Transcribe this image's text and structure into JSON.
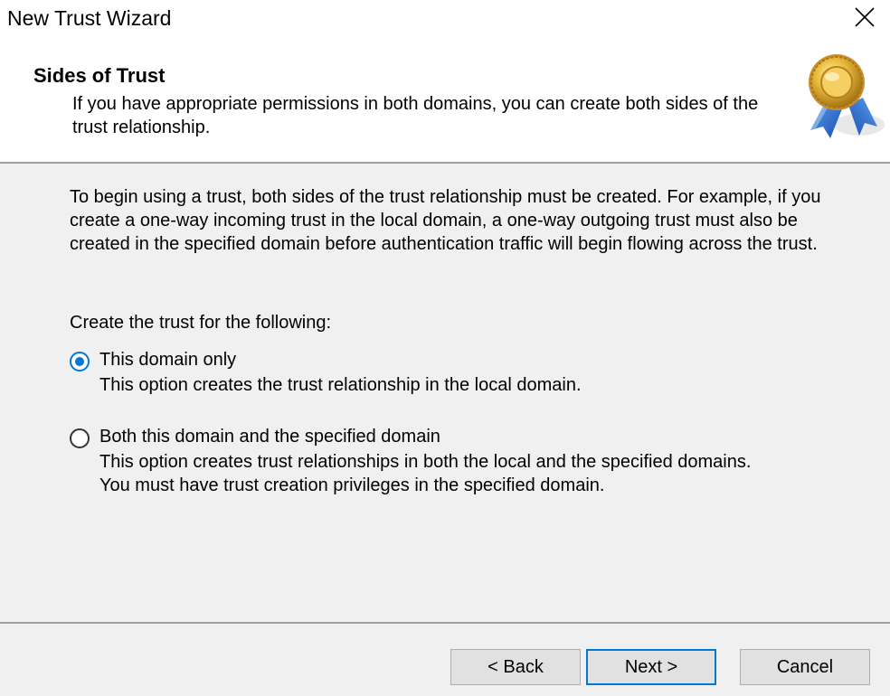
{
  "window": {
    "title": "New Trust Wizard"
  },
  "header": {
    "title": "Sides of Trust",
    "description": "If you have appropriate permissions in both domains, you can create both sides of the trust relationship."
  },
  "body": {
    "intro": "To begin using a trust, both sides of the trust relationship must be created. For example, if you create a one-way incoming trust in the local domain, a one-way outgoing trust must also be created in the specified domain before authentication traffic will begin flowing across the trust.",
    "prompt": "Create the trust for the following:",
    "options": [
      {
        "label": "This domain only",
        "description_lines": [
          "This option creates the trust relationship in the local domain."
        ],
        "selected": true
      },
      {
        "label": "Both this domain and the specified domain",
        "description_lines": [
          "This option creates trust relationships in both the local and the specified domains.",
          "You must have trust creation privileges in the specified domain."
        ],
        "selected": false
      }
    ]
  },
  "buttons": {
    "back": "< Back",
    "next": "Next >",
    "cancel": "Cancel"
  },
  "colors": {
    "accent": "#0078d7",
    "header_bg": "#ffffff",
    "body_bg": "#f0f0f0"
  },
  "icons": {
    "close": "close-icon",
    "header": "award-ribbon-icon"
  }
}
